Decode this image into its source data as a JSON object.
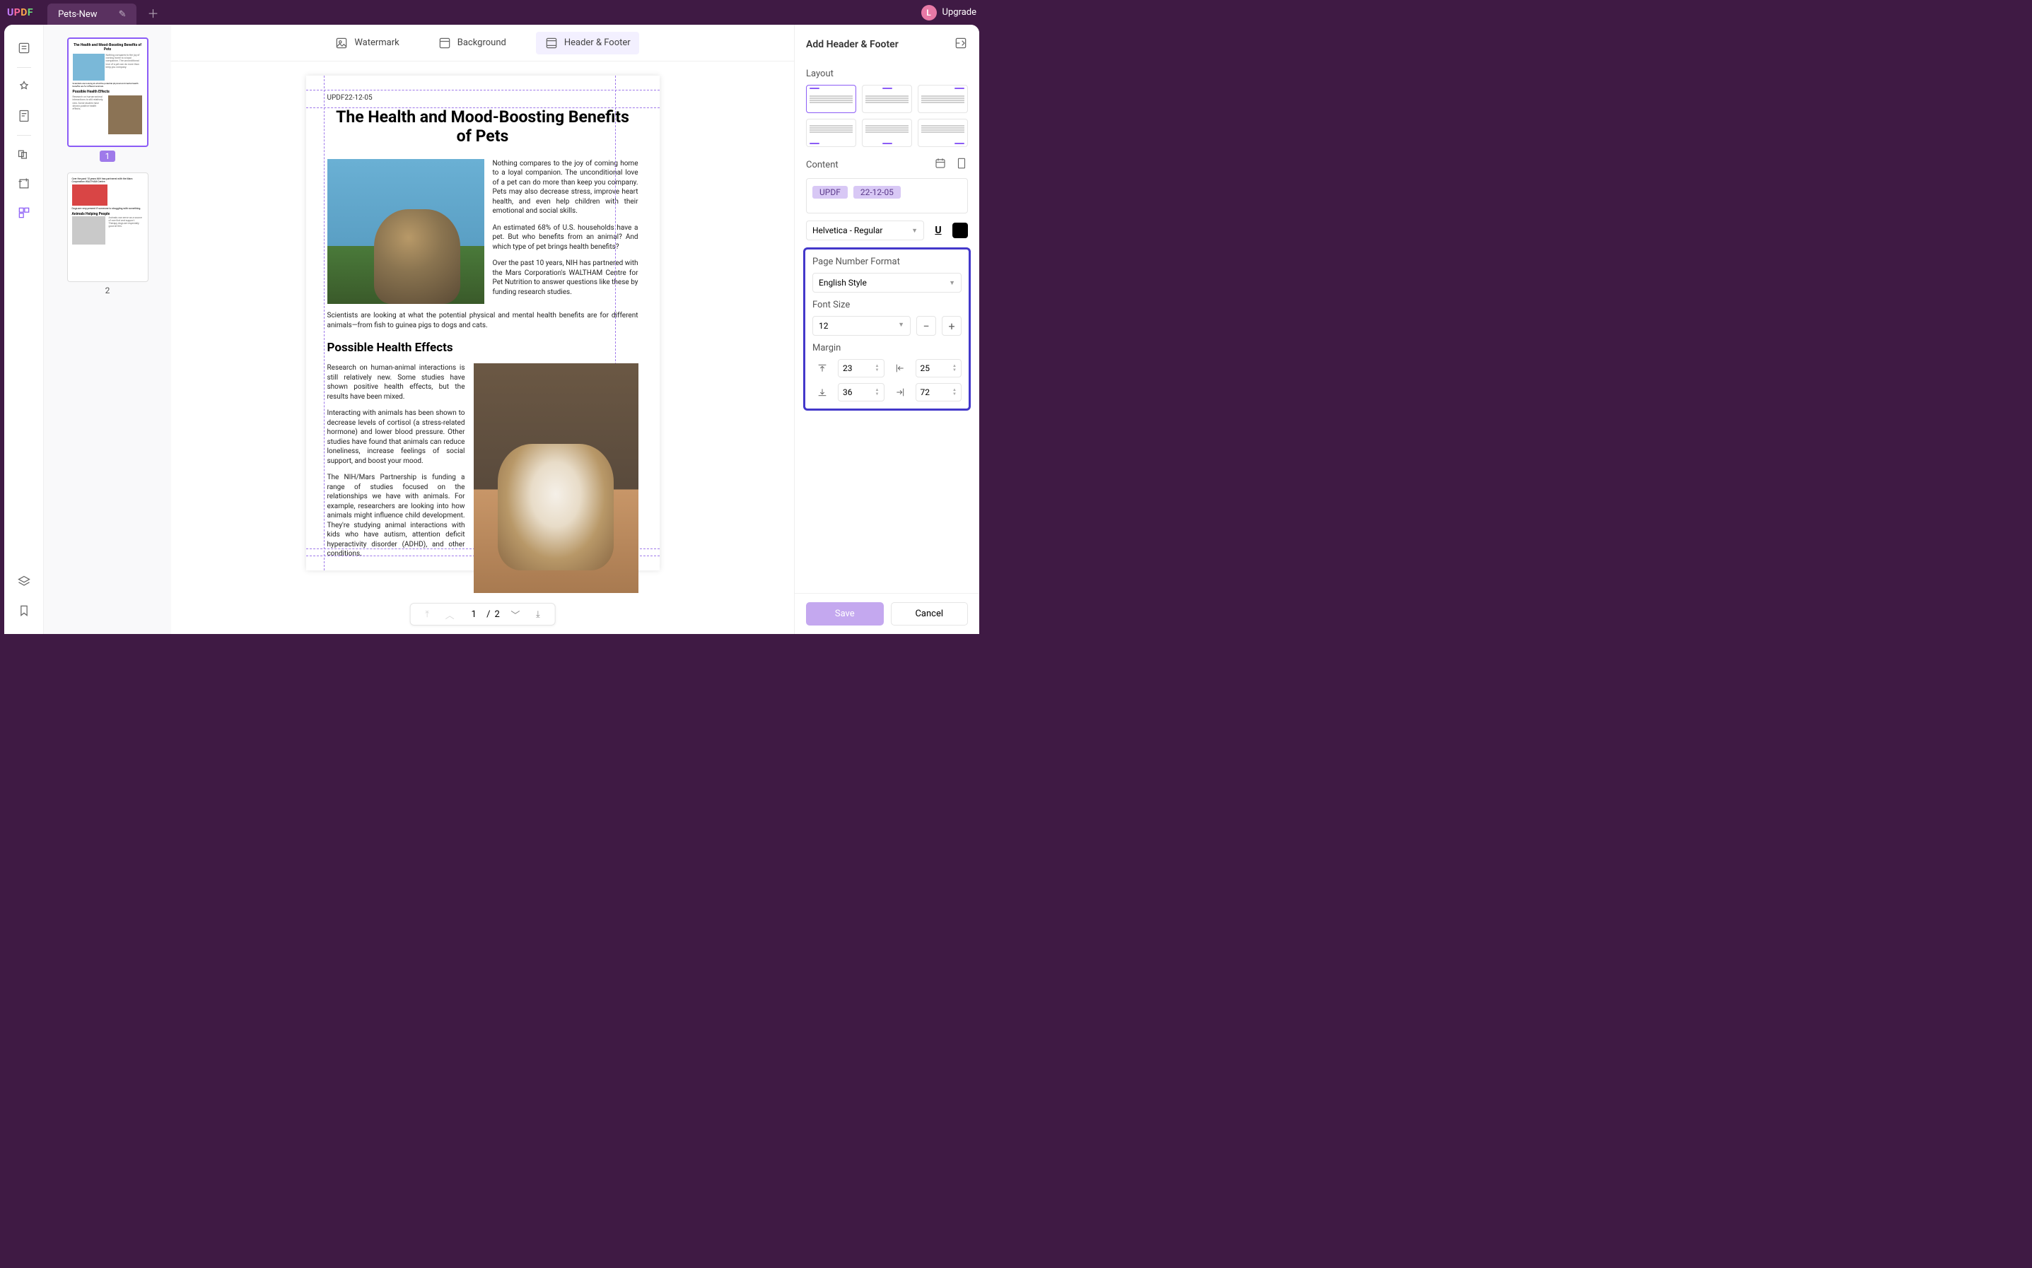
{
  "titlebar": {
    "logo": "UPDF",
    "tab_name": "Pets-New",
    "upgrade": "Upgrade",
    "avatar_letter": "L"
  },
  "topbar": {
    "watermark": "Watermark",
    "background": "Background",
    "header_footer": "Header & Footer"
  },
  "thumbs": {
    "page1": "1",
    "page2": "2"
  },
  "document": {
    "header_stamp": "UPDF22-12-05",
    "title": "The Health and Mood-Boosting Benefits of Pets",
    "p1": "Nothing compares to the joy of coming home to a loyal companion. The unconditional love of a pet can do more than keep you company. Pets may also decrease stress, improve heart health, and even help children with their emotional and social skills.",
    "p2": "An estimated 68% of U.S. households have a pet. But who benefits from an animal? And which type of pet brings health benefits?",
    "p3": "Over the past 10 years, NIH has partnered with the Mars Corporation's WALTHAM Centre for Pet Nutrition to answer questions like these by funding research studies.",
    "p4": "Scientists are looking at what the potential physical and mental health benefits are for different animals—from fish to guinea pigs to dogs and cats.",
    "h2": "Possible Health Effects",
    "p5": "Research on human-animal interactions is still relatively new. Some studies have shown positive health effects, but the results have been mixed.",
    "p6": "Interacting with animals has been shown to decrease levels of cortisol (a stress-related hormone) and lower blood pressure. Other studies have found that animals can reduce loneliness, increase feelings of social support, and boost your mood.",
    "p7": "The NIH/Mars Partnership is funding a range of studies focused on the relationships we have with animals. For example, researchers are looking into how animals might influence child development. They're studying animal interactions with kids who have autism, attention deficit hyperactivity disorder (ADHD), and other conditions."
  },
  "pager": {
    "current": "1",
    "sep": "/",
    "total": "2"
  },
  "panel": {
    "title": "Add Header & Footer",
    "layout_label": "Layout",
    "content_label": "Content",
    "chip1": "UPDF",
    "chip2": "22-12-05",
    "font": "Helvetica - Regular",
    "pnf_label": "Page Number Format",
    "pnf_value": "English Style",
    "fontsize_label": "Font Size",
    "fontsize_value": "12",
    "margin_label": "Margin",
    "m_top": "23",
    "m_left": "25",
    "m_bottom": "36",
    "m_right": "72",
    "save": "Save",
    "cancel": "Cancel"
  }
}
